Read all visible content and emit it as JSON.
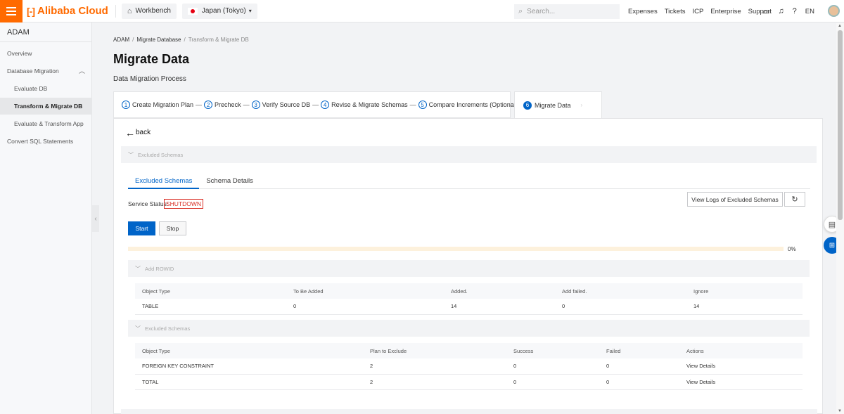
{
  "topbar": {
    "brand": "Alibaba Cloud",
    "workbench": "Workbench",
    "region": "Japan (Tokyo)",
    "search_placeholder": "Search...",
    "links": [
      "Expenses",
      "Tickets",
      "ICP",
      "Enterprise",
      "Support"
    ],
    "language": "EN"
  },
  "sidebar": {
    "title": "ADAM",
    "items": [
      {
        "label": "Overview"
      },
      {
        "label": "Database Migration"
      },
      {
        "label": "Evaluate DB"
      },
      {
        "label": "Transform & Migrate DB"
      },
      {
        "label": "Evaluate & Transform App"
      },
      {
        "label": "Convert SQL Statements"
      }
    ]
  },
  "breadcrumb": {
    "items": [
      "ADAM",
      "Migrate Database",
      "Transform & Migrate DB"
    ]
  },
  "page": {
    "title": "Migrate Data",
    "subtitle": "Data Migration Process"
  },
  "steps": [
    {
      "num": "1",
      "label": "Create Migration Plan"
    },
    {
      "num": "2",
      "label": "Precheck"
    },
    {
      "num": "3",
      "label": "Verify Source DB"
    },
    {
      "num": "4",
      "label": "Revise & Migrate Schemas"
    },
    {
      "num": "5",
      "label": "Compare Increments (Optional)"
    },
    {
      "num": "6",
      "label": "Migrate Data"
    }
  ],
  "back_label": "back",
  "section_excluded_top": "Excluded Schemas",
  "tabs": [
    "Excluded Schemas",
    "Schema Details"
  ],
  "service": {
    "label": "Service Status:",
    "value": "SHUTDOWN"
  },
  "buttons": {
    "view_logs": "View Logs of Excluded Schemas",
    "start": "Start",
    "stop": "Stop"
  },
  "progress": {
    "percent": 0,
    "label": "0%"
  },
  "add_rowid": {
    "title": "Add ROWID",
    "columns": [
      "Object Type",
      "To Be Added",
      "Added.",
      "Add failed.",
      "Ignore"
    ],
    "rows": [
      [
        "TABLE",
        "0",
        "14",
        "0",
        "14"
      ]
    ]
  },
  "excluded": {
    "title": "Excluded Schemas",
    "columns": [
      "Object Type",
      "Plan to Exclude",
      "Success",
      "Failed",
      "Actions"
    ],
    "rows": [
      [
        "FOREIGN KEY CONSTRAINT",
        "2",
        "0",
        "0",
        "View Details"
      ],
      [
        "TOTAL",
        "2",
        "0",
        "0",
        "View Details"
      ]
    ]
  },
  "colors": {
    "brand": "#ff6a00",
    "primary": "#0064c8",
    "status_shutdown": "#d93026"
  }
}
